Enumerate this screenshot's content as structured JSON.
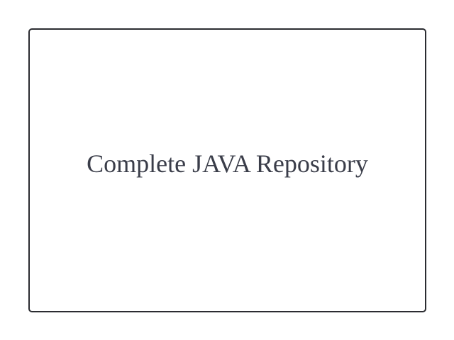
{
  "card": {
    "title": "Complete JAVA Repository"
  },
  "colors": {
    "background": "#ffffff",
    "border": "#2b2c31",
    "text": "#3a3d49"
  }
}
